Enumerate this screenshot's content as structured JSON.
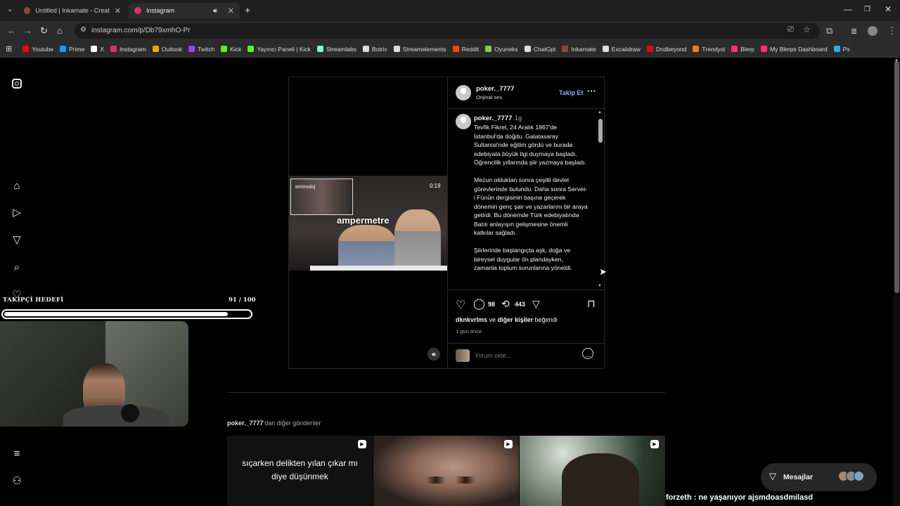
{
  "tabs": [
    {
      "title": "Untitled | Inkarnate - Create Fa",
      "active": false,
      "favicon_color": "#8a4a3a"
    },
    {
      "title": "Instagram",
      "active": true,
      "favicon_color": "#d6336c",
      "audio_icon": "speaker-icon"
    }
  ],
  "address": {
    "url": "instagram.com/p/Db79xmhO-Pr"
  },
  "bookmarks": [
    {
      "label": "Youtube",
      "color": "#ff0000"
    },
    {
      "label": "Prime",
      "color": "#1a98ff"
    },
    {
      "label": "X",
      "color": "#ffffff"
    },
    {
      "label": "Instagram",
      "color": "#d6336c"
    },
    {
      "label": "Outlook",
      "color": "#f0a30a"
    },
    {
      "label": "Twitch",
      "color": "#9146ff"
    },
    {
      "label": "Kick",
      "color": "#53fc18"
    },
    {
      "label": "Yayıncı Paneli | Kick",
      "color": "#53fc18"
    },
    {
      "label": "Streamlabs",
      "color": "#80f5d2"
    },
    {
      "label": "Botrix",
      "color": "#dddddd"
    },
    {
      "label": "Streamelements",
      "color": "#dddddd"
    },
    {
      "label": "Reddit",
      "color": "#ff4500"
    },
    {
      "label": "Oyuneks",
      "color": "#7cd34a"
    },
    {
      "label": "ChatGpt",
      "color": "#dddddd"
    },
    {
      "label": "Inkarnate",
      "color": "#8a4a3a"
    },
    {
      "label": "Excalidraw",
      "color": "#dddddd"
    },
    {
      "label": "Dndbeyond",
      "color": "#e40712"
    },
    {
      "label": "Trendyol",
      "color": "#f27a1a"
    },
    {
      "label": "Blerp",
      "color": "#ff3366"
    },
    {
      "label": "My Blerps Dashboard",
      "color": "#ff3366"
    },
    {
      "label": "Ps",
      "color": "#31a8ff"
    }
  ],
  "post": {
    "author": "poker._7777",
    "audio": "Orijinal ses",
    "follow_label": "Takip Et",
    "video_caption": "ampermetre",
    "video_time": "0:19",
    "pip_label": "terimoloj",
    "comment_author": "poker._7777",
    "comment_age": "1g",
    "comment_paragraphs": [
      "Tevfik Fikret, 24 Aralık 1867'de İstanbul'da doğdu. Galatasaray Sultanisi'nde eğitim gördü ve burada edebiyata büyük ilgi duymaya başladı. Öğrencilik yıllarında şiir yazmaya başladı.",
      "Mezun olduktan sonra çeşitli devlet görevlerinde bulundu. Daha sonra Servet-i Fünûn dergisinin başına geçerek dönemin genç şair ve yazarlarını bir araya getirdi. Bu dönemde Türk edebiyatında Batılı anlayışın gelişmesine önemli katkılar sağladı.",
      "Şiirlerinde başlangıçta aşk, doğa ve bireysel duygular ön plandayken, zamanla toplum sorunlarına yöneldi."
    ],
    "comments_count": "98",
    "reposts_count": "443",
    "liked_by_user": "dknkvrlms",
    "liked_by_connector": "ve",
    "liked_by_others": "diğer kişiler",
    "liked_by_suffix": "beğendi",
    "posted_ago": "1 gün önce",
    "comment_placeholder": "Yorum ekle..."
  },
  "more_posts": {
    "title_user": "poker._7777",
    "title_suffix": "'dan diğer gönderiler",
    "items": [
      {
        "overlay_text": "sıçarken delikten yılan çıkar mı\ndiye düşünmek"
      },
      {
        "overlay_text": ""
      },
      {
        "overlay_text": ""
      }
    ]
  },
  "messages": {
    "label": "Mesajlar"
  },
  "stream_overlay": {
    "goal_title": "TAKİPÇİ HEDEFİ",
    "goal_count": "91 / 100",
    "goal_progress": 0.91,
    "chat_message": "forzeth : ne yaşanıyor ajsmdoasdmilasd"
  }
}
